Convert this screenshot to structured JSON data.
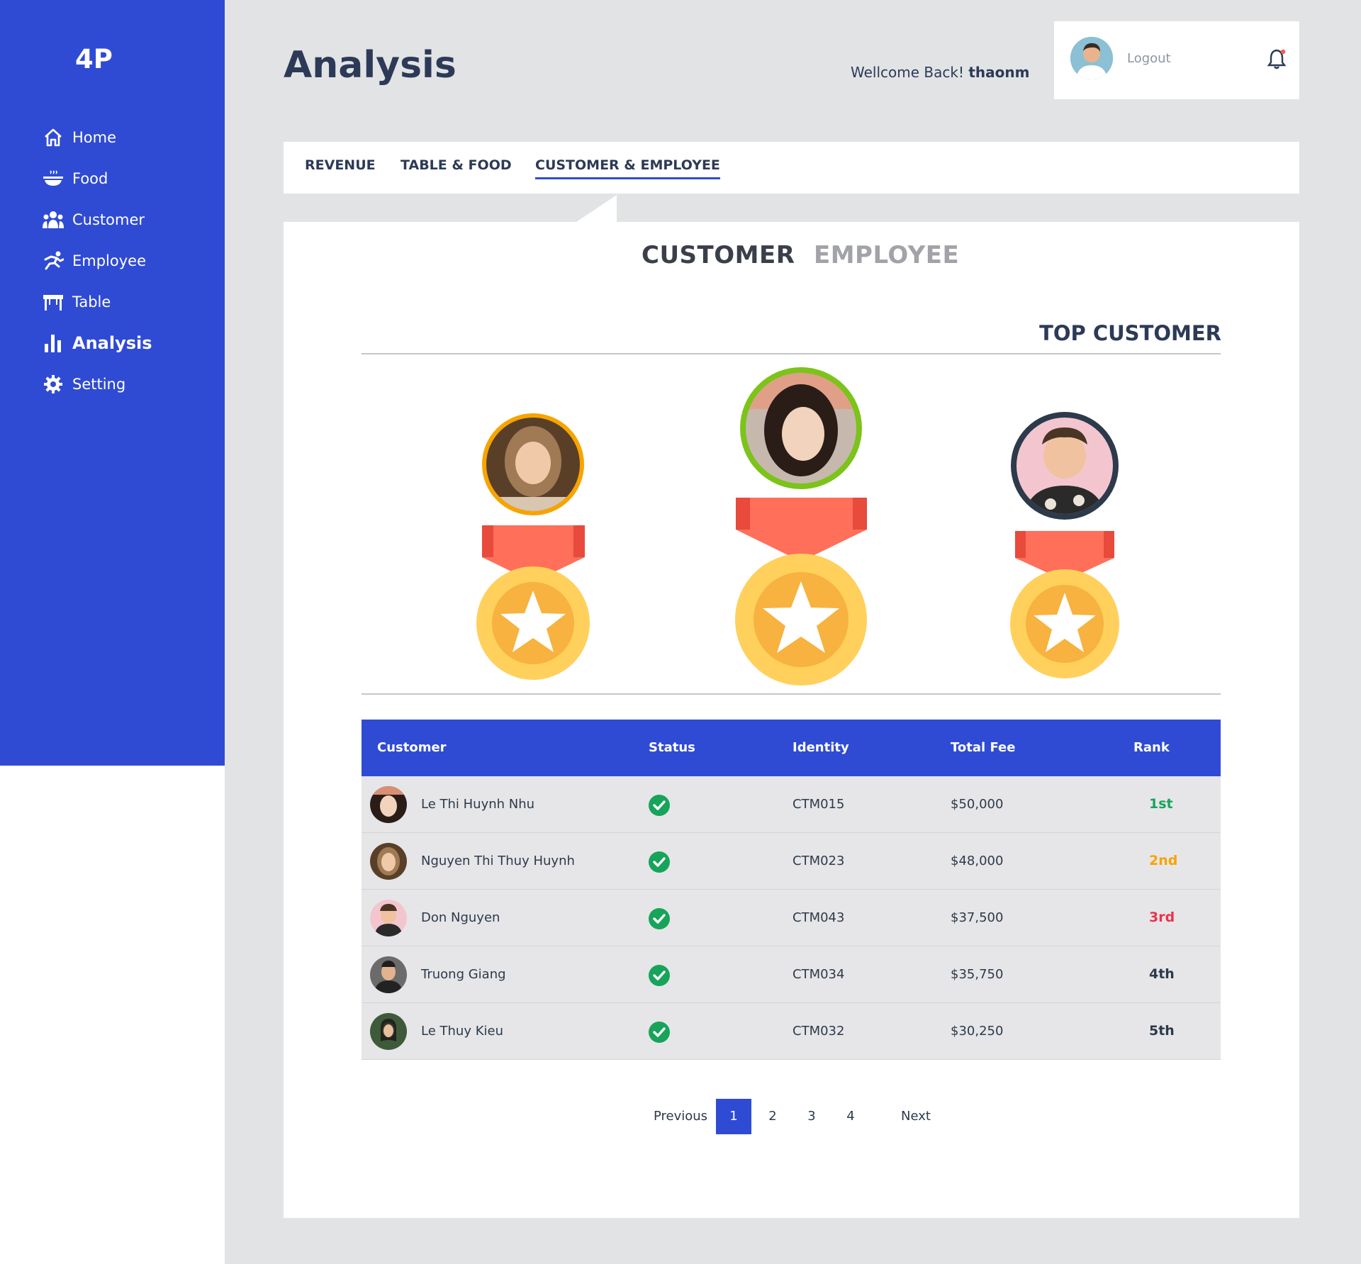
{
  "app": {
    "logo": "4P"
  },
  "sidebar": {
    "items": [
      {
        "label": "Home",
        "icon": "home-icon",
        "active": false
      },
      {
        "label": "Food",
        "icon": "food-bowl-icon",
        "active": false
      },
      {
        "label": "Customer",
        "icon": "users-icon",
        "active": false
      },
      {
        "label": "Employee",
        "icon": "running-person-icon",
        "active": false
      },
      {
        "label": "Table",
        "icon": "table-icon",
        "active": false
      },
      {
        "label": "Analysis",
        "icon": "bar-chart-icon",
        "active": true
      },
      {
        "label": "Setting",
        "icon": "gear-icon",
        "active": false
      }
    ]
  },
  "header": {
    "title": "Analysis",
    "welcome_prefix": "Wellcome Back!",
    "username": "thaonm",
    "logout_label": "Logout"
  },
  "tabs": [
    {
      "label": "REVENUE",
      "active": false
    },
    {
      "label": "TABLE & FOOD",
      "active": false
    },
    {
      "label": "CUSTOMER & EMPLOYEE",
      "active": true
    }
  ],
  "switch": {
    "customer_label": "CUSTOMER",
    "employee_label": "EMPLOYEE",
    "active": "CUSTOMER"
  },
  "top_section": {
    "title": "TOP CUSTOMER",
    "medal_ring_colors": {
      "first": "#7cc31a",
      "second": "#f7a400",
      "third": "#2d3a4b"
    }
  },
  "table": {
    "headers": [
      "Customer",
      "Status",
      "Identity",
      "Total Fee",
      "Rank"
    ],
    "rows": [
      {
        "name": "Le Thi Huynh Nhu",
        "status": "active",
        "identity": "CTM015",
        "fee": "$50,000",
        "rank": "1st",
        "rank_color": "#17a45a"
      },
      {
        "name": "Nguyen Thi Thuy Huynh",
        "status": "active",
        "identity": "CTM023",
        "fee": "$48,000",
        "rank": "2nd",
        "rank_color": "#f7a400"
      },
      {
        "name": "Don Nguyen",
        "status": "active",
        "identity": "CTM043",
        "fee": "$37,500",
        "rank": "3rd",
        "rank_color": "#e8344e"
      },
      {
        "name": "Truong Giang",
        "status": "active",
        "identity": "CTM034",
        "fee": "$35,750",
        "rank": "4th",
        "rank_color": "#2d3a4b"
      },
      {
        "name": "Le Thuy Kieu",
        "status": "active",
        "identity": "CTM032",
        "fee": "$30,250",
        "rank": "5th",
        "rank_color": "#2d3a4b"
      }
    ]
  },
  "pagination": {
    "previous_label": "Previous",
    "next_label": "Next",
    "pages": [
      "1",
      "2",
      "3",
      "4"
    ],
    "current": "1"
  },
  "colors": {
    "primary": "#2f4bd4",
    "background": "#e2e3e5"
  }
}
